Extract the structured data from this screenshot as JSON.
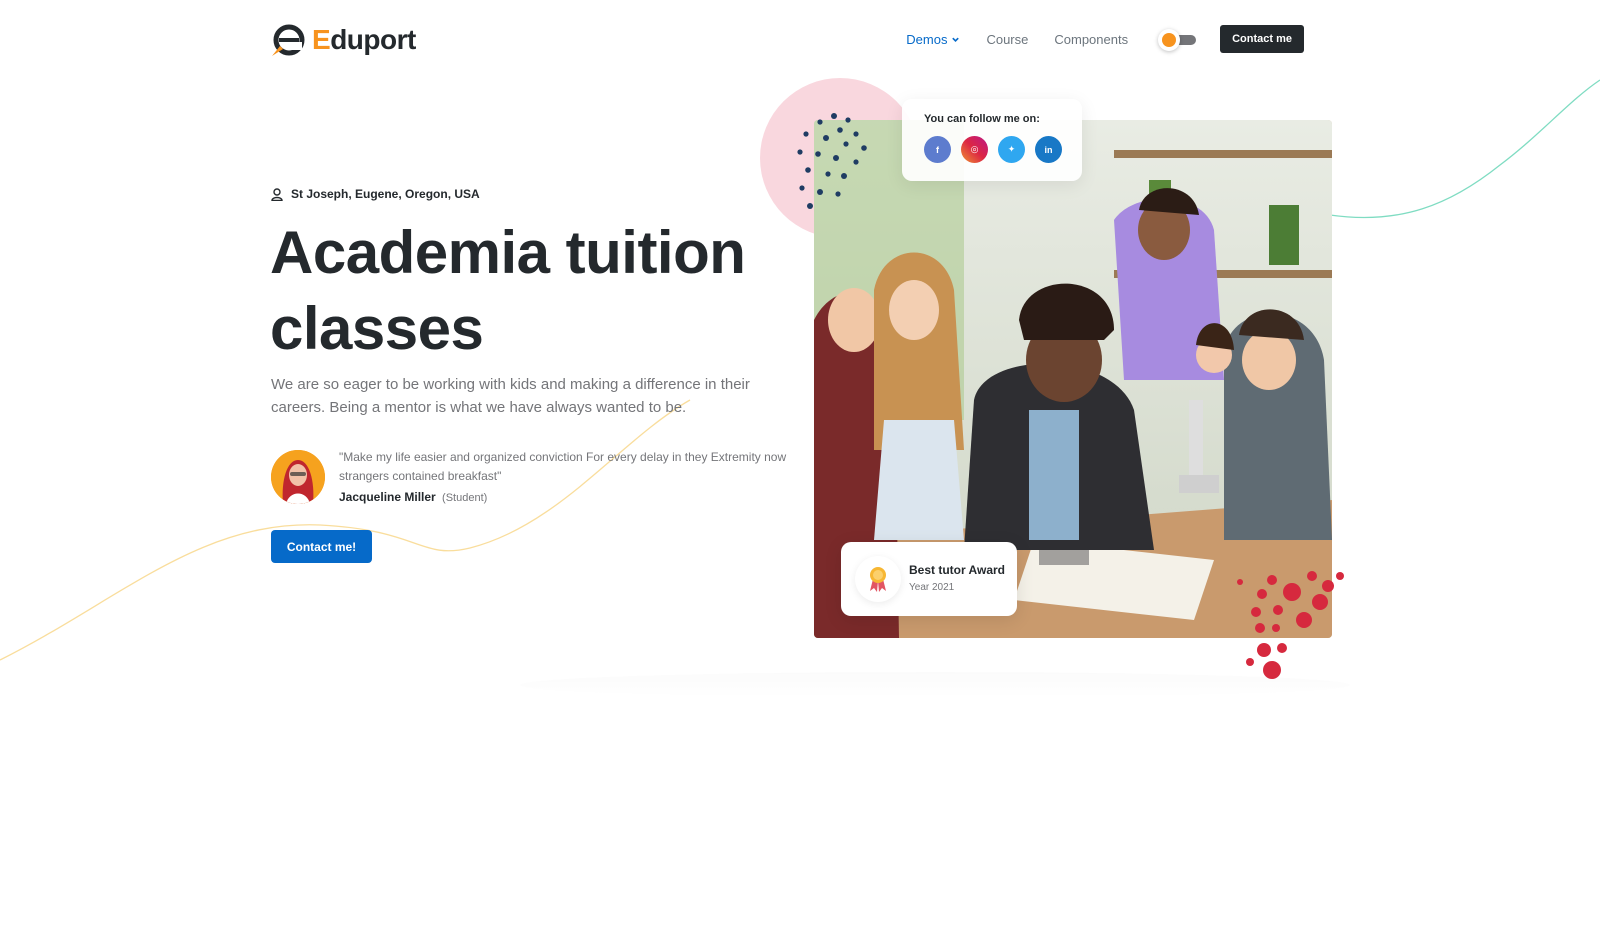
{
  "brand": {
    "name_first": "E",
    "name_rest": "duport",
    "accent": "#f7931e",
    "primary": "#066ac9",
    "dark": "#24292d"
  },
  "nav": {
    "items": [
      {
        "label": "Demos",
        "active": true,
        "has_dropdown": true
      },
      {
        "label": "Course",
        "active": false
      },
      {
        "label": "Components",
        "active": false
      }
    ],
    "theme_toggle": "sun-icon",
    "contact_label": "Contact me"
  },
  "hero": {
    "location": "St Joseph, Eugene, Oregon, USA",
    "title": "Academia tuition classes",
    "description": "We are so eager to be working with kids and making a difference in their careers. Being a mentor is what we have always wanted to be.",
    "testimonial": {
      "quote": "\"Make my life easier and organized conviction For every delay in they Extremity now strangers contained breakfast\"",
      "author": "Jacqueline Miller",
      "role": "(Student)"
    },
    "cta_label": "Contact me!"
  },
  "follow": {
    "title": "You can follow me on:",
    "socials": [
      {
        "name": "facebook-icon",
        "glyph": "f",
        "color": "#5d7cce"
      },
      {
        "name": "instagram-icon",
        "glyph": "◎",
        "color": "#e1306c"
      },
      {
        "name": "twitter-icon",
        "glyph": "✦",
        "color": "#2fa7f0"
      },
      {
        "name": "linkedin-icon",
        "glyph": "in",
        "color": "#1878c6"
      }
    ]
  },
  "award": {
    "title": "Best tutor Award",
    "year": "Year 2021"
  }
}
